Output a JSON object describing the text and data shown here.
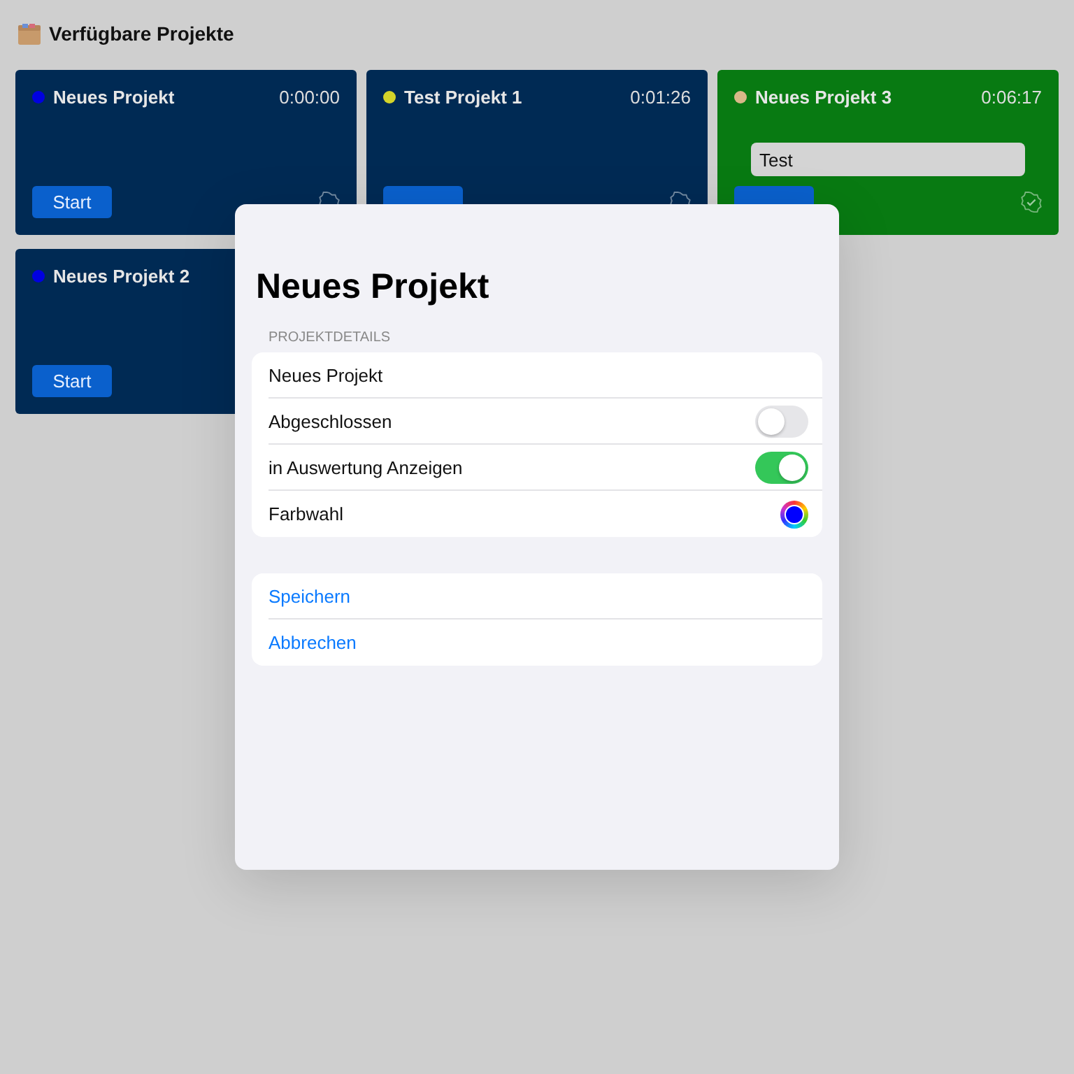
{
  "header": {
    "title": "Verfügbare Projekte"
  },
  "projects": [
    {
      "name": "Neues Projekt",
      "time": "0:00:00",
      "color": "#0000e0",
      "running": false,
      "button": "Start"
    },
    {
      "name": "Test Projekt 1",
      "time": "0:01:26",
      "color": "#d4d42a",
      "running": false
    },
    {
      "name": "Neues Projekt 3",
      "time": "0:06:17",
      "color": "#d8b888",
      "running": true,
      "note": "Test"
    },
    {
      "name": "Neues Projekt 2",
      "color": "#0000e0",
      "button": "Start"
    }
  ],
  "dialog": {
    "title": "Neues Projekt",
    "section": "PROJEKTDETAILS",
    "rows": [
      {
        "kind": "text",
        "label": "Neues Projekt"
      },
      {
        "kind": "toggle",
        "label": "Abgeschlossen",
        "on": false
      },
      {
        "kind": "toggle",
        "label": "in Auswertung Anzeigen",
        "on": true
      },
      {
        "kind": "color",
        "label": "Farbwahl",
        "color": "#0000ff"
      }
    ],
    "actions": [
      "Speichern",
      "Abbrechen"
    ]
  }
}
